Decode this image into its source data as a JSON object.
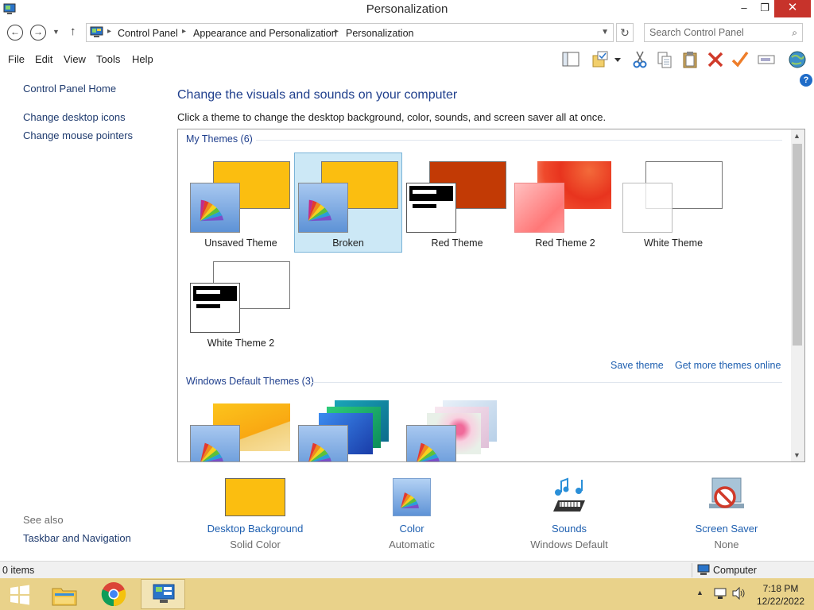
{
  "window": {
    "title": "Personalization",
    "controls": {
      "minimize": "–",
      "maximize": "❐",
      "close": "✕"
    }
  },
  "address_bar": {
    "breadcrumbs": [
      "Control Panel",
      "Appearance and Personalization",
      "Personalization"
    ],
    "separator": "▸",
    "search_placeholder": "Search Control Panel"
  },
  "menu": [
    "File",
    "Edit",
    "View",
    "Tools",
    "Help"
  ],
  "toolbar_icons": [
    "layout-pane-icon",
    "folder-options-icon",
    "dropdown-arrow-icon",
    "cut-icon",
    "copy-icon",
    "paste-icon",
    "delete-icon",
    "properties-check-icon",
    "rename-icon",
    "globe-icon"
  ],
  "left_nav": {
    "links": [
      "Control Panel Home",
      "Change desktop icons",
      "Change mouse pointers"
    ],
    "see_also_label": "See also",
    "see_also_links": [
      "Taskbar and Navigation"
    ]
  },
  "main": {
    "heading": "Change the visuals and sounds on your computer",
    "subheading": "Click a theme to change the desktop background, color, sounds, and screen saver all at once.",
    "help_icon_label": "?"
  },
  "themes": {
    "my_themes_header": "My Themes (6)",
    "my_themes": [
      {
        "name": "Unsaved Theme",
        "selected": false,
        "style": "yellow-palette"
      },
      {
        "name": "Broken",
        "selected": true,
        "style": "yellow-palette"
      },
      {
        "name": "Red Theme",
        "selected": false,
        "style": "red-contrast"
      },
      {
        "name": "Red Theme 2",
        "selected": false,
        "style": "red-gradient"
      },
      {
        "name": "White Theme",
        "selected": false,
        "style": "white"
      },
      {
        "name": "White Theme 2",
        "selected": false,
        "style": "white-contrast"
      }
    ],
    "save_theme_link": "Save theme",
    "get_more_link": "Get more themes online",
    "default_themes_header": "Windows Default Themes (3)",
    "default_themes": [
      {
        "style": "windows"
      },
      {
        "style": "lines-and-colors"
      },
      {
        "style": "flowers"
      }
    ]
  },
  "settings": [
    {
      "name": "Desktop Background",
      "value": "Solid Color",
      "icon": "solid-color-swatch-icon"
    },
    {
      "name": "Color",
      "value": "Automatic",
      "icon": "color-palette-icon"
    },
    {
      "name": "Sounds",
      "value": "Windows Default",
      "icon": "sounds-music-icon"
    },
    {
      "name": "Screen Saver",
      "value": "None",
      "icon": "screen-saver-none-icon"
    }
  ],
  "status_bar": {
    "item_count": "0 items",
    "zone": "Computer"
  },
  "taskbar": {
    "time": "7:18 PM",
    "date": "12/22/2022",
    "apps": [
      "start-icon",
      "file-explorer-icon",
      "chrome-icon",
      "control-panel-icon"
    ]
  },
  "colors": {
    "accent_yellow": "#fbbe10",
    "link_blue": "#1e5fb0",
    "heading_blue": "#1e3e8c",
    "taskbar": "#e9d28a",
    "selection": "#cce8f6",
    "close_button": "#c7332b"
  }
}
